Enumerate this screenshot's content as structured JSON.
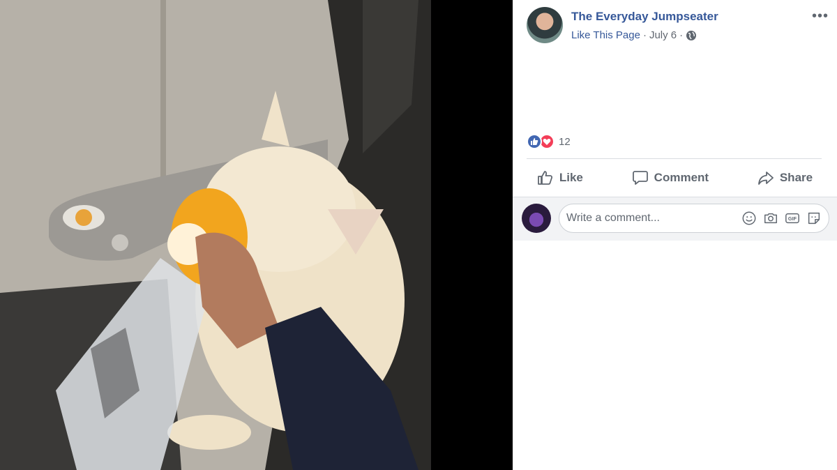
{
  "post": {
    "page_name": "The Everyday Jumpseater",
    "like_page": "Like This Page",
    "separator": "·",
    "date": "July 6"
  },
  "reactions": {
    "count": "12",
    "types": [
      "like-icon",
      "love-icon"
    ]
  },
  "actions": {
    "like": "Like",
    "comment": "Comment",
    "share": "Share"
  },
  "comment": {
    "placeholder": "Write a comment..."
  },
  "icons": {
    "more": "more-options-icon",
    "privacy": "globe-icon",
    "comment_tools": [
      "emoji-icon",
      "camera-icon",
      "gif-icon",
      "sticker-icon"
    ]
  },
  "colors": {
    "link": "#365899",
    "like_blue": "#4267b2",
    "love_red": "#f33e58",
    "muted": "#606770"
  }
}
